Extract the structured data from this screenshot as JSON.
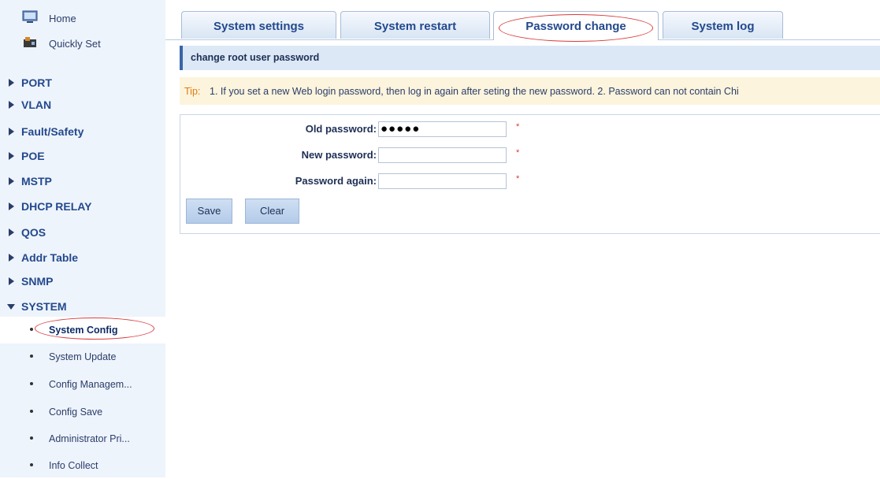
{
  "sidebar": {
    "top_items": [
      {
        "label": "Home",
        "icon": "monitor-icon"
      },
      {
        "label": "Quickly Set",
        "icon": "wizard-icon"
      }
    ],
    "menu": [
      {
        "label": "PORT",
        "expanded": false
      },
      {
        "label": "VLAN",
        "expanded": false
      },
      {
        "label": "Fault/Safety",
        "expanded": false
      },
      {
        "label": "POE",
        "expanded": false
      },
      {
        "label": "MSTP",
        "expanded": false
      },
      {
        "label": "DHCP RELAY",
        "expanded": false
      },
      {
        "label": "QOS",
        "expanded": false
      },
      {
        "label": "Addr Table",
        "expanded": false
      },
      {
        "label": "SNMP",
        "expanded": false
      },
      {
        "label": "SYSTEM",
        "expanded": true
      }
    ],
    "system_subitems": [
      {
        "label": "System Config",
        "active": true
      },
      {
        "label": "System Update",
        "active": false
      },
      {
        "label": "Config Managem...",
        "active": false
      },
      {
        "label": "Config Save",
        "active": false
      },
      {
        "label": "Administrator Pri...",
        "active": false
      },
      {
        "label": "Info Collect",
        "active": false
      }
    ]
  },
  "tabs": [
    {
      "label": "System settings",
      "active": false
    },
    {
      "label": "System restart",
      "active": false
    },
    {
      "label": "Password change",
      "active": true
    },
    {
      "label": "System log",
      "active": false
    }
  ],
  "section": {
    "title": "change root user password"
  },
  "tip": {
    "label": "Tip:",
    "text": "1. If you set a new Web login password, then log in again after seting the new password.  2. Password can not contain Chi"
  },
  "form": {
    "old_password": {
      "label": "Old password:",
      "value": "●●●●●",
      "required": "*"
    },
    "new_password": {
      "label": "New password:",
      "value": "",
      "required": "*"
    },
    "password_again": {
      "label": "Password again:",
      "value": "",
      "required": "*"
    },
    "save_label": "Save",
    "clear_label": "Clear"
  },
  "colors": {
    "sidebar_bg": "#eef4fb",
    "menu_text": "#23498d",
    "section_bar": "#dce8f6",
    "tip_bg": "#fcf4dc",
    "tip_label": "#e07a10",
    "highlight_oval": "#d83a3a"
  }
}
